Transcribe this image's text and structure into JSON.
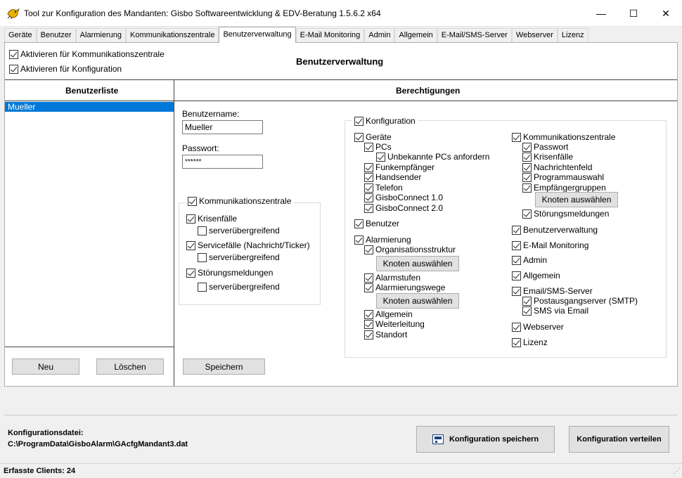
{
  "window": {
    "title": "Tool zur Konfiguration des Mandanten: Gisbo Softwareentwicklung & EDV-Beratung 1.5.6.2 x64",
    "minimize": "—",
    "maximize": "☐",
    "close": "✕"
  },
  "tabs": [
    "Geräte",
    "Benutzer",
    "Alarmierung",
    "Kommunikationszentrale",
    "Benutzerverwaltung",
    "E-Mail Monitoring",
    "Admin",
    "Allgemein",
    "E-Mail/SMS-Server",
    "Webserver",
    "Lizenz"
  ],
  "active_tab": "Benutzerverwaltung",
  "top": {
    "activate_kz": "Aktivieren für Kommunikationszentrale",
    "activate_config": "Aktivieren für Konfiguration",
    "heading": "Benutzerverwaltung"
  },
  "userlist": {
    "header": "Benutzerliste",
    "users": [
      "Mueller"
    ],
    "new_button": "Neu",
    "delete_button": "Löschen"
  },
  "permissions": {
    "header": "Berechtigungen",
    "username_label": "Benutzername:",
    "username_value": "Mueller",
    "password_label": "Passwort:",
    "password_value": "******",
    "save_button": "Speichern",
    "kz_group": {
      "title": "Kommunikationszentrale",
      "krisen": "Krisenfälle",
      "krisen_sub": "serverübergreifend",
      "service": "Servicefälle (Nachricht/Ticker)",
      "service_sub": "serverübergreifend",
      "stoerung": "Störungsmeldungen",
      "stoerung_sub": "serverübergreifend"
    },
    "config": {
      "title": "Konfiguration",
      "geraete": "Geräte",
      "pcs": "PCs",
      "unbekannte": "Unbekannte PCs anfordern",
      "funk": "Funkempfänger",
      "hand": "Handsender",
      "telefon": "Telefon",
      "gc1": "GisboConnect 1.0",
      "gc2": "GisboConnect 2.0",
      "benutzer": "Benutzer",
      "alarmierung": "Alarmierung",
      "orga": "Organisationsstruktur",
      "knoten1": "Knoten auswählen",
      "alarmstufen": "Alarmstufen",
      "alarmwege": "Alarmierungswege",
      "knoten2": "Knoten auswählen",
      "allgemein_sub": "Allgemein",
      "weiterleitung": "Weiterleitung",
      "standort": "Standort",
      "kz": "Kommunikationszentrale",
      "passwort": "Passwort",
      "krisen": "Krisenfälle",
      "nachricht": "Nachrichtenfeld",
      "programm": "Programmauswahl",
      "empfaenger": "Empfängergruppen",
      "knoten3": "Knoten auswählen",
      "stoerung": "Störungsmeldungen",
      "benutzerverwaltung": "Benutzerverwaltung",
      "email_mon": "E-Mail Monitoring",
      "admin": "Admin",
      "allgemein": "Allgemein",
      "email_sms": "Email/SMS-Server",
      "smtp": "Postausgangserver (SMTP)",
      "sms_email": "SMS via Email",
      "webserver": "Webserver",
      "lizenz": "Lizenz"
    }
  },
  "footer": {
    "config_label": "Konfigurationsdatei:",
    "config_path": "C:\\ProgramData\\GisboAlarm\\GAcfgMandant3.dat",
    "save_config": "Konfiguration speichern",
    "distribute_config": "Konfiguration verteilen",
    "status": "Erfasste Clients: 24"
  }
}
